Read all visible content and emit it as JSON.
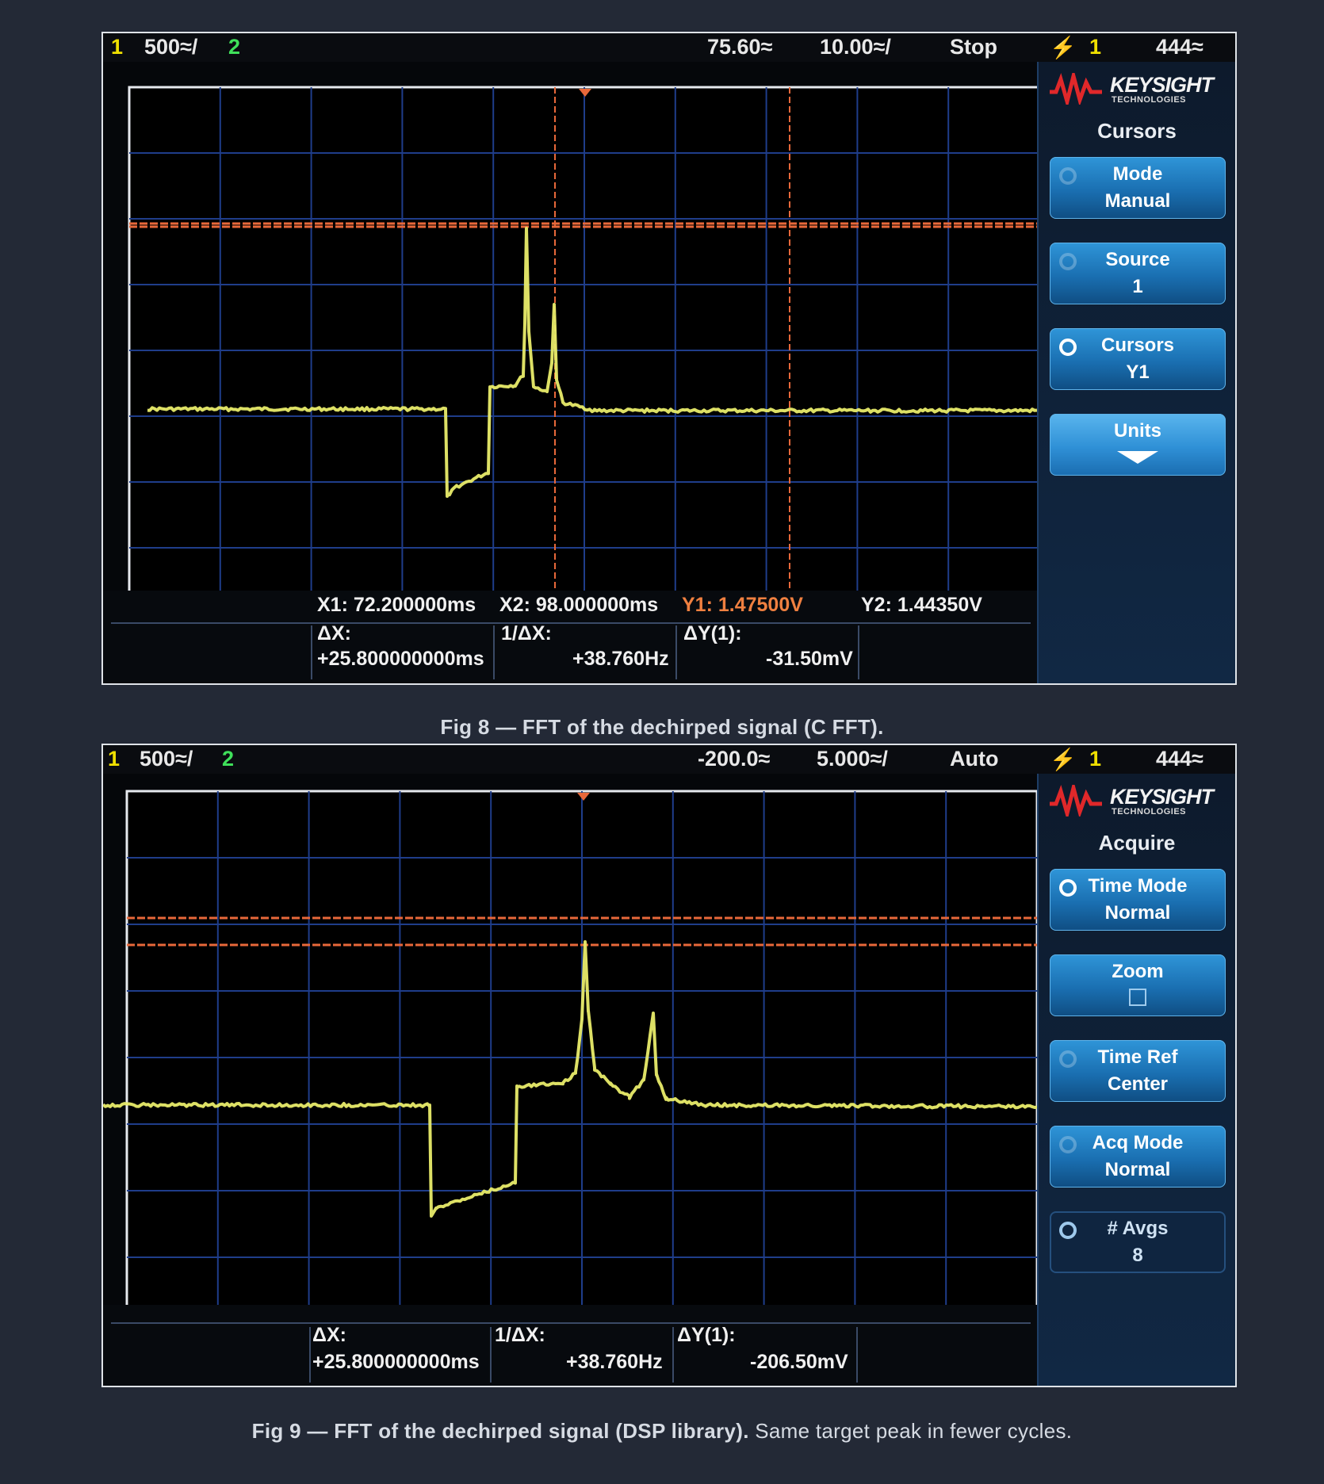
{
  "fig8": {
    "topbar": {
      "ch1_num": "1",
      "ch1_scale": "500",
      "ch1_scale_suffix": "≈/",
      "ch2_num": "2",
      "delay": "75.60≈",
      "timebase": "10.00≈/",
      "run_state": "Stop",
      "trigger_source": "1",
      "trigger_level": "444≈"
    },
    "panel": {
      "brand": "KEYSIGHT",
      "brand_sub": "TECHNOLOGIES",
      "title": "Cursors",
      "softkeys": [
        {
          "line1": "Mode",
          "line2": "Manual"
        },
        {
          "line1": "Source",
          "line2": "1"
        },
        {
          "line1": "Cursors",
          "line2": "Y1"
        },
        {
          "line1": "Units",
          "line2": ""
        }
      ]
    },
    "measurements": {
      "x1": "X1:  72.200000ms",
      "x2": "X2:  98.000000ms",
      "y1": "Y1:  1.47500V",
      "y2": "Y2:  1.44350V",
      "dx_label": "ΔX:",
      "dx_value": "+25.800000000ms",
      "inv_dx_label": "1/ΔX:",
      "inv_dx_value": "+38.760Hz",
      "dy_label": "ΔY(1):",
      "dy_value": "-31.50mV"
    },
    "caption": "Fig 8 — FFT of the dechirped signal (C FFT)."
  },
  "fig9": {
    "topbar": {
      "ch1_num": "1",
      "ch1_scale": "500",
      "ch1_scale_suffix": "≈/",
      "ch2_num": "2",
      "delay": "-200.0≈",
      "timebase": "5.000≈/",
      "run_state": "Auto",
      "trigger_source": "1",
      "trigger_level": "444≈"
    },
    "panel": {
      "brand": "KEYSIGHT",
      "brand_sub": "TECHNOLOGIES",
      "title": "Acquire",
      "softkeys": [
        {
          "line1": "Time Mode",
          "line2": "Normal"
        },
        {
          "line1": "Zoom",
          "line2": ""
        },
        {
          "line1": "Time Ref",
          "line2": "Center"
        },
        {
          "line1": "Acq Mode",
          "line2": "Normal"
        },
        {
          "line1": "# Avgs",
          "line2": "8"
        }
      ]
    },
    "measurements": {
      "dx_label": "ΔX:",
      "dx_value": "+25.800000000ms",
      "inv_dx_label": "1/ΔX:",
      "inv_dx_value": "+38.760Hz",
      "dy_label": "ΔY(1):",
      "dy_value": "-206.50mV"
    },
    "caption_bold": "Fig 9 — FFT of the dechirped signal (DSP library).",
    "caption_rest": " Same target peak in fewer cycles."
  },
  "colors": {
    "grid": "#1f3d8a",
    "trace": "#e9ec6a",
    "cursor": "#e8683a",
    "softkey": "#1f7cc2"
  },
  "icons": [
    "keysight-logo-icon",
    "trigger-icon",
    "softkey-ring-icon",
    "down-arrow-icon",
    "zoom-box-icon"
  ]
}
